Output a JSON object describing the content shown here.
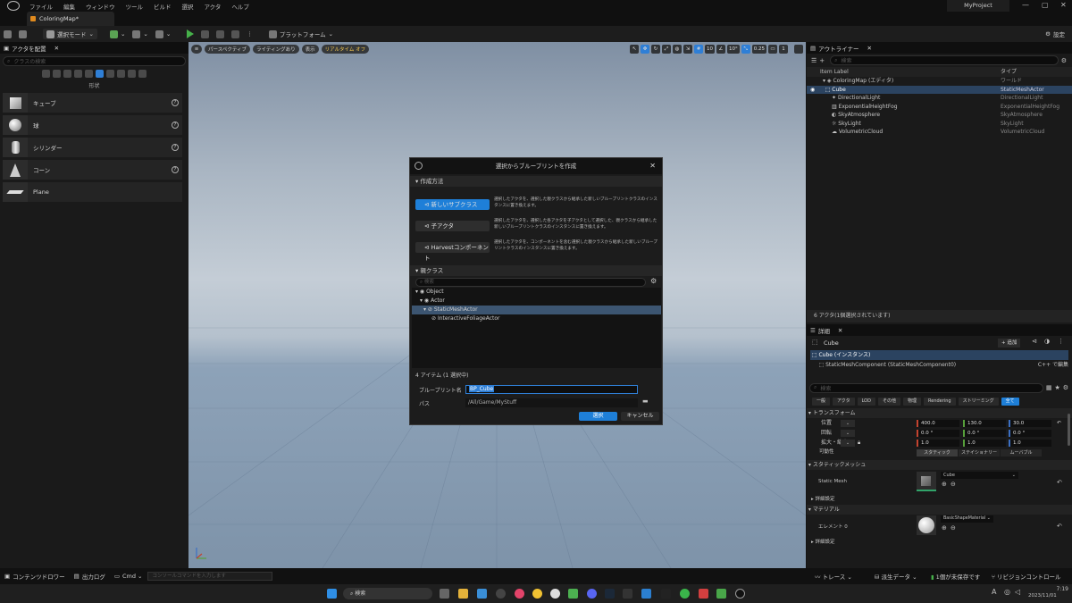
{
  "menubar": {
    "items": [
      "ファイル",
      "編集",
      "ウィンドウ",
      "ツール",
      "ビルド",
      "選択",
      "アクタ",
      "ヘルプ"
    ],
    "project_name": "MyProject",
    "window_controls": [
      "—",
      "▢",
      "✕"
    ]
  },
  "document_tab": {
    "label": "ColoringMap*"
  },
  "toolbar": {
    "mode_label": "選択モード",
    "platform_label": "プラットフォーム",
    "settings_label": "設定"
  },
  "place_actors": {
    "title": "アクタを配置",
    "search_placeholder": "クラスの検索",
    "category_label": "形状",
    "items": [
      {
        "label": "キューブ"
      },
      {
        "label": "球"
      },
      {
        "label": "シリンダー"
      },
      {
        "label": "コーン"
      },
      {
        "label": "Plane"
      }
    ]
  },
  "viewport": {
    "buttons": [
      "パースペクティブ",
      "ライティングあり",
      "表示",
      "リアルタイム オフ"
    ],
    "right_tools": [
      "10",
      "10°",
      "0.25",
      "1"
    ]
  },
  "dialog": {
    "title": "選択からブループリントを作成",
    "section_method": "作成方法",
    "options": [
      {
        "label": "新しいサブクラス",
        "desc": "選択したアクタを、選択した親クラスから継承した新しいブループリントクラスのインスタンスに置き換えます。",
        "selected": true
      },
      {
        "label": "子アクタ",
        "desc": "選択したアクタを、選択した各アクタを子アクタとして選択した、親クラスから継承した新しいブループリントクラスのインスタンスに置き換えます。",
        "selected": false
      },
      {
        "label": "Harvestコンポーネント",
        "desc": "選択したアクタを、コンポーネントを含む選択した親クラスから継承した新しいブループリントクラスのインスタンスに置き換えます。",
        "selected": false
      }
    ],
    "section_parent": "親クラス",
    "search_placeholder": "検索",
    "tree": [
      {
        "label": "Object",
        "level": 0,
        "selected": false
      },
      {
        "label": "Actor",
        "level": 1,
        "selected": false
      },
      {
        "label": "StaticMeshActor",
        "level": 2,
        "selected": true
      },
      {
        "label": "InteractiveFoliageActor",
        "level": 3,
        "selected": false
      }
    ],
    "item_count": "4 アイテム (1 選択中)",
    "name_label": "ブループリント名",
    "name_value": "BP_Cube",
    "path_label": "パス",
    "path_value": "/All/Game/MyStuff",
    "select_button": "選択",
    "cancel_button": "キャンセル"
  },
  "outliner": {
    "title": "アウトライナー",
    "search_placeholder": "検索",
    "col_label": "Item Label",
    "col_type": "タイプ",
    "rows": [
      {
        "name": "ColoringMap (エディタ)",
        "type": "ワールド",
        "indent": 0,
        "selected": false
      },
      {
        "name": "Cube",
        "type": "StaticMeshActor",
        "indent": 1,
        "selected": true
      },
      {
        "name": "DirectionalLight",
        "type": "DirectionalLight",
        "indent": 1,
        "selected": false
      },
      {
        "name": "ExponentialHeightFog",
        "type": "ExponentialHeightFog",
        "indent": 1,
        "selected": false
      },
      {
        "name": "SkyAtmosphere",
        "type": "SkyAtmosphere",
        "indent": 1,
        "selected": false
      },
      {
        "name": "SkyLight",
        "type": "SkyLight",
        "indent": 1,
        "selected": false
      },
      {
        "name": "VolumetricCloud",
        "type": "VolumetricCloud",
        "indent": 1,
        "selected": false
      }
    ],
    "status": "6 アクタ(1個選択されています)"
  },
  "details": {
    "title": "詳細",
    "object_name": "Cube",
    "add_button": "+ 追加",
    "instance_label": "Cube (インスタンス)",
    "component_label": "StaticMeshComponent (StaticMeshComponent0)",
    "edit_in_cpp": "C++ で編集",
    "search_placeholder": "検索",
    "tabs": [
      "一般",
      "アクタ",
      "LOD",
      "その他",
      "物理",
      "Rendering",
      "ストリーミング",
      "全て"
    ],
    "transform_section": "トランスフォーム",
    "location_label": "位置",
    "location": [
      "400.0",
      "130.0",
      "30.0"
    ],
    "rotation_label": "回転",
    "rotation": [
      "0.0 °",
      "0.0 °",
      "0.0 °"
    ],
    "scale_label": "拡大・縮小",
    "scale": [
      "1.0",
      "1.0",
      "1.0"
    ],
    "mobility_label": "可動性",
    "mobility_options": [
      "スタティック",
      "ステイショナリー",
      "ムーバブル"
    ],
    "static_mesh_section": "スタティックメッシュ",
    "static_mesh_label": "Static Mesh",
    "static_mesh_value": "Cube",
    "advanced_label": "詳細設定",
    "materials_section": "マテリアル",
    "element_label": "エレメント 0",
    "material_value": "BasicShapeMaterial",
    "advanced_label2": "詳細設定"
  },
  "bottombar": {
    "content_drawer": "コンテンツドロワー",
    "output_log": "出力ログ",
    "cmd": "Cmd",
    "console_placeholder": "コンソールコマンドを入力します",
    "trace": "トレース",
    "derived_data": "派生データ",
    "unsaved": "1個が未保存です",
    "source_control": "リビジョンコントロール"
  },
  "taskbar": {
    "search_placeholder": "検索",
    "time": "7:19",
    "date": "2023/11/01"
  }
}
